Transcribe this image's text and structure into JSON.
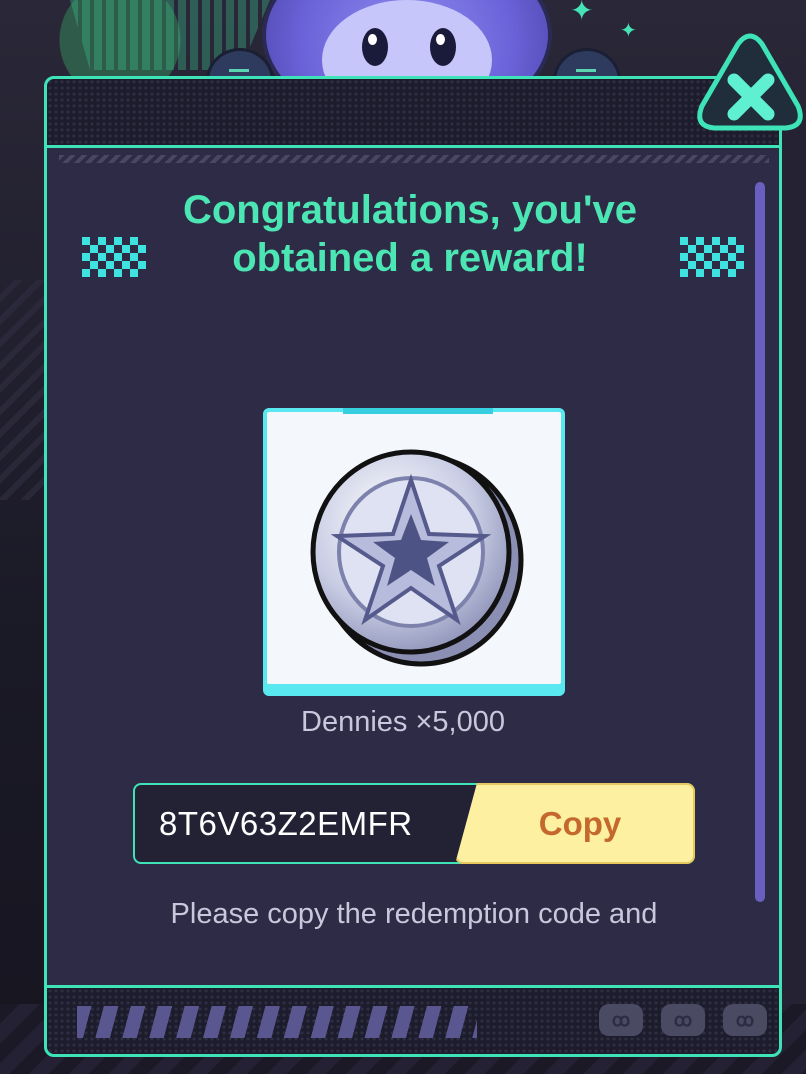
{
  "title": "Congratulations, you've obtained a reward!",
  "reward": {
    "item_name": "Dennies ×5,000",
    "icon": "silver-star-coin-icon"
  },
  "redemption": {
    "code": "8T6V63Z2EMFR",
    "copy_label": "Copy"
  },
  "instructions": "Please copy the redemption code and",
  "colors": {
    "accent": "#3ee3b8",
    "title": "#4be6b3",
    "panel": "#2d2b45",
    "copy_bg": "#fdf0a0",
    "copy_text": "#c5682e",
    "scrollbar": "#6a5fc0"
  }
}
